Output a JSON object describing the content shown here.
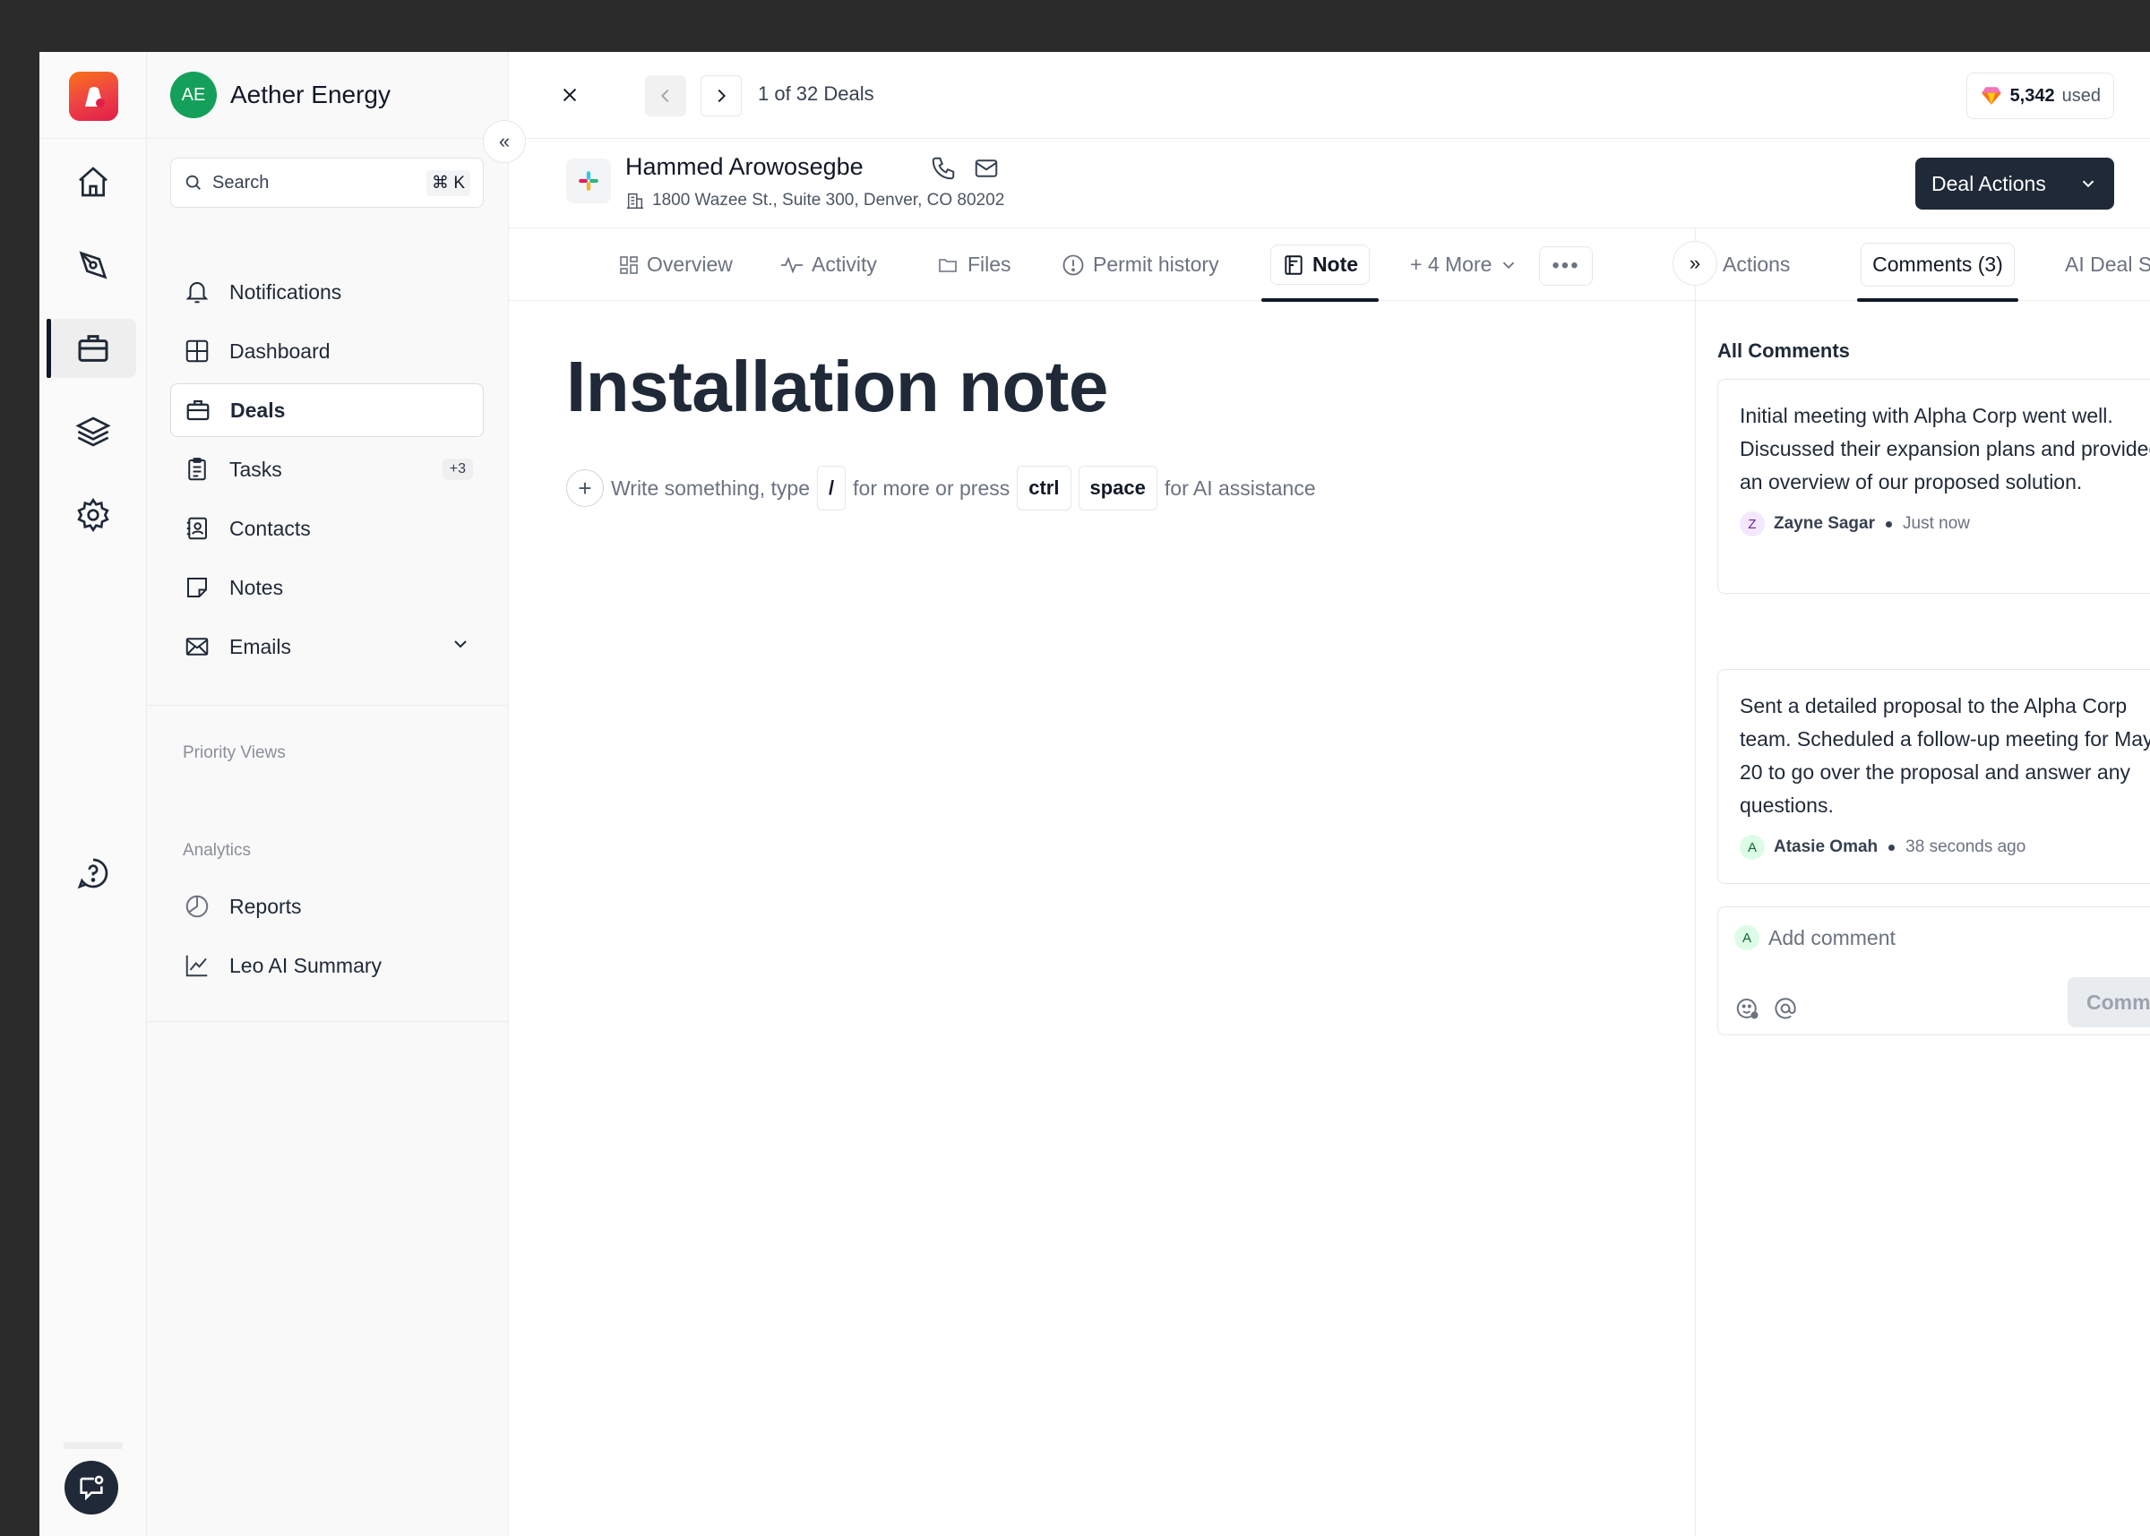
{
  "org": {
    "initials": "AE",
    "name": "Aether Energy"
  },
  "search": {
    "placeholder": "Search",
    "shortcut": "⌘ K"
  },
  "nav": {
    "notifications": "Notifications",
    "dashboard": "Dashboard",
    "deals": "Deals",
    "tasks": "Tasks",
    "tasks_badge": "+3",
    "contacts": "Contacts",
    "notes": "Notes",
    "emails": "Emails"
  },
  "sections": {
    "priority_views": "Priority Views",
    "analytics": "Analytics",
    "reports": "Reports",
    "leo_ai_summary": "Leo AI Summary"
  },
  "topbar": {
    "count": "1 of 32 Deals",
    "credits_value": "5,342",
    "credits_label": "used"
  },
  "deal": {
    "name": "Hammed Arowosegbe",
    "address": "1800 Wazee St., Suite 300, Denver, CO 80202",
    "actions_label": "Deal Actions"
  },
  "tabs": {
    "overview": "Overview",
    "activity": "Activity",
    "files": "Files",
    "permit_history": "Permit history",
    "note": "Note",
    "more": "+ 4 More"
  },
  "right_tabs": {
    "actions": "Actions",
    "comments": "Comments (3)",
    "ai_scope": "AI Deal Scope"
  },
  "comments": {
    "heading": "All Comments",
    "items": [
      {
        "text": "Initial meeting with Alpha Corp went well. Discussed their expansion plans and provided an overview of our proposed solution.",
        "initial": "Z",
        "author": "Zayne Sagar",
        "time": "Just now"
      },
      {
        "text": "Sent a detailed proposal to the Alpha Corp team. Scheduled a follow-up meeting for May 20 to go over the proposal and answer any questions.",
        "initial": "A",
        "author": "Atasie Omah",
        "time": "38 seconds ago"
      }
    ],
    "add_initial": "A",
    "add_placeholder": "Add comment",
    "submit": "Comment"
  },
  "editor": {
    "title": "Installation note",
    "hint_1": "Write something, type",
    "key_slash": "/",
    "hint_2": "for more or press",
    "key_ctrl": "ctrl",
    "key_space": "space",
    "hint_3": "for AI assistance"
  },
  "colors": {
    "accent_dark": "#1f2937",
    "org_green": "#14a05a",
    "logo_red": "#ef4444"
  }
}
